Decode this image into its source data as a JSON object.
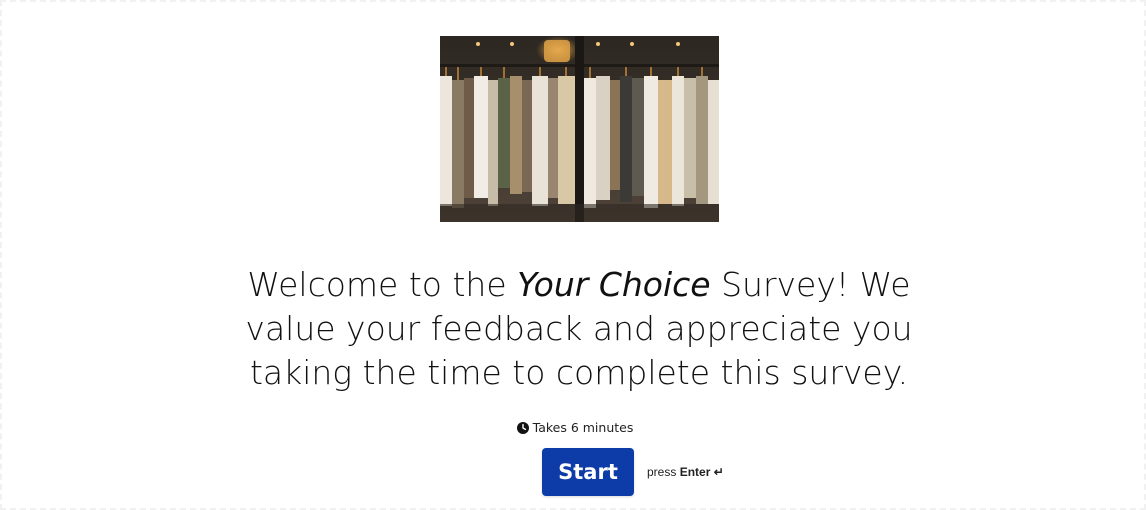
{
  "welcome": {
    "line_prefix": "Welcome to the ",
    "survey_name": "Your Choice",
    "line_suffix": " Survey! We value your feedback and appreciate you taking the time to complete this survey."
  },
  "duration": {
    "icon": "clock-icon",
    "text": "Takes 6 minutes"
  },
  "start_button": {
    "label": "Start"
  },
  "hint": {
    "prefix": "press ",
    "key": "Enter",
    "key_symbol": "↵"
  },
  "colors": {
    "primary": "#0d3ba8",
    "text": "#111111",
    "background": "#ffffff"
  }
}
